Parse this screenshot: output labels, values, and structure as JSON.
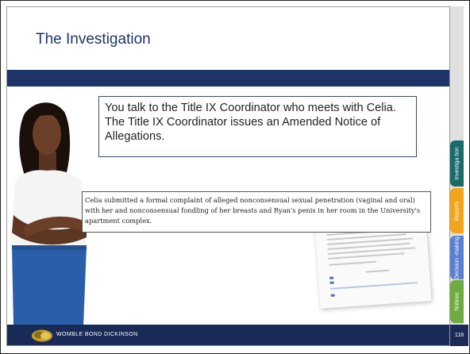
{
  "slide": {
    "title": "The Investigation",
    "callout": "You talk to the Title IX Coordinator who meets with Celia. The Title IX Coordinator issues an Amended Notice of Allegations.",
    "document_excerpt": "Celia submitted a formal complaint of alleged nonconsensual sexual penetration (vaginal and oral) with her and nonconsensual fondling of her breasts and Ryan's penis in her room in the University's apartment complex."
  },
  "footer": {
    "brand": "WOMBLE BOND DICKINSON",
    "page_number": "118"
  },
  "tabs": [
    {
      "label": "Investiga tion",
      "color": "#1b6a6a"
    },
    {
      "label": "Reports",
      "color": "#f2a51b"
    },
    {
      "label": "Decision -making",
      "color": "#5b7fd1"
    },
    {
      "label": "Notices",
      "color": "#6fab3e"
    }
  ],
  "colors": {
    "title": "#1f3468",
    "navy": "#1a2a56"
  }
}
